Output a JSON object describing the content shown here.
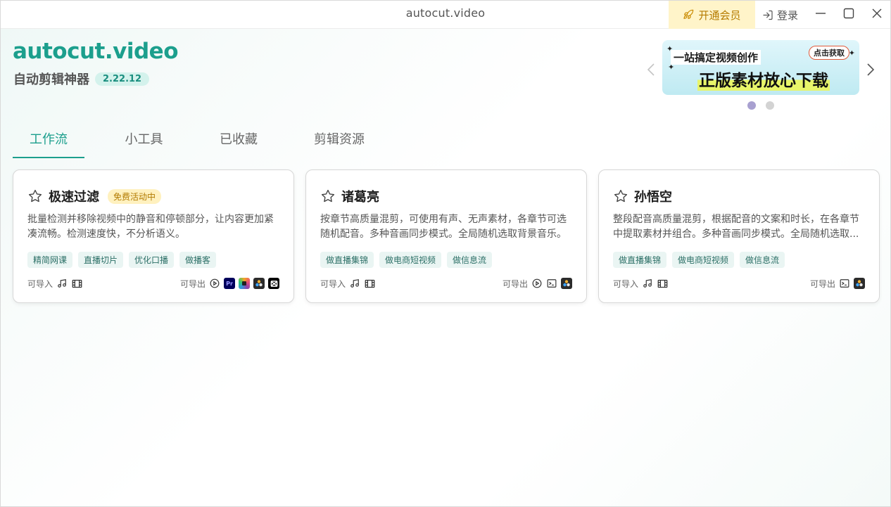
{
  "window": {
    "title": "autocut.video"
  },
  "titlebar": {
    "vip_label": "开通会员",
    "login_label": "登录",
    "accent": "#1c9f8d"
  },
  "header": {
    "brand": "autocut.video",
    "subtitle": "自动剪辑神器",
    "version": "2.22.12"
  },
  "banner": {
    "line1": "一站搞定视频创作",
    "line2": "正版素材放心下载",
    "cta": "点击获取",
    "dots_count": 2,
    "active_dot": 0
  },
  "tabs": [
    {
      "label": "工作流",
      "active": true
    },
    {
      "label": "小工具",
      "active": false
    },
    {
      "label": "已收藏",
      "active": false
    },
    {
      "label": "剪辑资源",
      "active": false
    }
  ],
  "cards": [
    {
      "title": "极速过滤",
      "badge": "免费活动中",
      "description": "批量检测并移除视频中的静音和停顿部分，让内容更加紧凑流畅。检测速度快，不分析语义。",
      "tags": [
        "精简网课",
        "直播切片",
        "优化口播",
        "做播客"
      ],
      "import_label": "可导入",
      "export_label": "可导出",
      "imports": [
        "music-icon",
        "film-icon"
      ],
      "exports": [
        "play-circle-icon",
        "premiere-pro-icon",
        "final-cut-icon",
        "davinci-resolve-icon",
        "capcut-icon"
      ]
    },
    {
      "title": "诸葛亮",
      "badge": "",
      "description": "按章节高质量混剪，可使用有声、无声素材，各章节可选随机配音。多种音画同步模式。全局随机选取背景音乐。",
      "tags": [
        "做直播集锦",
        "做电商短视频",
        "做信息流"
      ],
      "import_label": "可导入",
      "export_label": "可导出",
      "imports": [
        "music-icon",
        "film-icon"
      ],
      "exports": [
        "play-circle-icon",
        "terminal-icon",
        "davinci-resolve-icon"
      ]
    },
    {
      "title": "孙悟空",
      "badge": "",
      "description": "整段配音高质量混剪，根据配音的文案和时长，在各章节中提取素材并组合。多种音画同步模式。全局随机选取...",
      "tags": [
        "做直播集锦",
        "做电商短视频",
        "做信息流"
      ],
      "import_label": "可导入",
      "export_label": "可导出",
      "imports": [
        "music-icon",
        "film-icon"
      ],
      "exports": [
        "terminal-icon",
        "davinci-resolve-icon"
      ]
    }
  ]
}
